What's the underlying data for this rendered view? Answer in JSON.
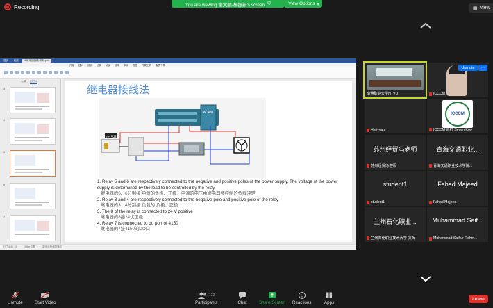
{
  "topbar": {
    "recording_label": "Recording",
    "viewing_text": "You are viewing 谢大顺-杨振邦's screen",
    "view_options_label": "View Options",
    "view_button_label": "View"
  },
  "screen": {
    "window_tabs": [
      "首页",
      "稻壳",
      "3-继电器接线-冲刺.pptx"
    ],
    "menu_items": [
      "开始",
      "插入",
      "设计",
      "切换",
      "动画",
      "放映",
      "审阅",
      "视图",
      "开发工具",
      "会员专享"
    ],
    "panel_tabs": [
      "大纲",
      "幻灯片"
    ],
    "thumb_numbers": [
      "3",
      "4",
      "5",
      "6",
      "7"
    ],
    "slide_title": "继电器接线法",
    "lines": [
      {
        "en": "1. Relay 5 and 6 are respectively connected to the negative and positive poles of the power supply. The voltage of the power supply is determined by the load to be controlled by the relay",
        "cn": "继电器的5、6分别接 电源的负极、正极，电源的电压由继电器要控制的负载决定"
      },
      {
        "en": "2. Relay 3 and 4 are respectively connected to the negative pole and positive pole of the relay",
        "cn": "继电器的3、4分别接 负载的 负极、正极"
      },
      {
        "en": "3. The 8 of the relay is connected to 24 V positive",
        "cn": "继电器的8接24伏正极"
      },
      {
        "en": "4. Relay 7 is connected to do port of 4150",
        "cn": "继电器的7接4150的DO口"
      }
    ],
    "status_text": [
      "幻灯片 5 / 10",
      "Office 主题",
      "单击此处添加备注"
    ],
    "module_label": "ADAM",
    "relay_label": "24V电源"
  },
  "participants": [
    {
      "name": "南通职业大学NTVU",
      "type": "camera-room",
      "muted": false,
      "active": true
    },
    {
      "name": "ICCCM",
      "type": "camera-face",
      "muted": true,
      "active": false
    },
    {
      "name": "Hafiyyan",
      "type": "blank",
      "muted": true,
      "active": false
    },
    {
      "name": "ICCCM 惠虹 Seven Koo",
      "type": "logo",
      "logo_text": "ICCCM",
      "muted": true,
      "active": false
    },
    {
      "name": "苏州经贸冯老师",
      "big": "苏州经贸冯老师",
      "type": "text",
      "muted": true,
      "active": false
    },
    {
      "name": "青海交通职业技术学院...",
      "big": "青海交通职业...",
      "type": "text",
      "muted": true,
      "active": false
    },
    {
      "name": "student1",
      "big": "student1",
      "type": "text",
      "muted": true,
      "active": false
    },
    {
      "name": "Fahad Majeed",
      "big": "Fahad Majeed",
      "type": "text",
      "muted": true,
      "active": false
    },
    {
      "name": "兰州石化职业技术大学-文晖",
      "big": "兰州石化职业...",
      "type": "text",
      "muted": true,
      "active": false
    },
    {
      "name": "Muhammad Saif ur Rehm...",
      "big": "Muhammad Saif...",
      "type": "text",
      "muted": true,
      "active": false
    }
  ],
  "tile_controls": {
    "unmute_label": "Unmute",
    "more_label": "···"
  },
  "toolbar": {
    "unmute": "Unmute",
    "start_video": "Start Video",
    "participants": "Participants",
    "participants_count": "122",
    "chat": "Chat",
    "share_screen": "Share Screen",
    "reactions": "Reactions",
    "apps": "Apps",
    "leave": "Leave"
  },
  "colors": {
    "accent_green": "#22b14c",
    "leave_red": "#e0312b",
    "active_speaker": "#c5d72a",
    "zoom_blue": "#0e72ed"
  }
}
